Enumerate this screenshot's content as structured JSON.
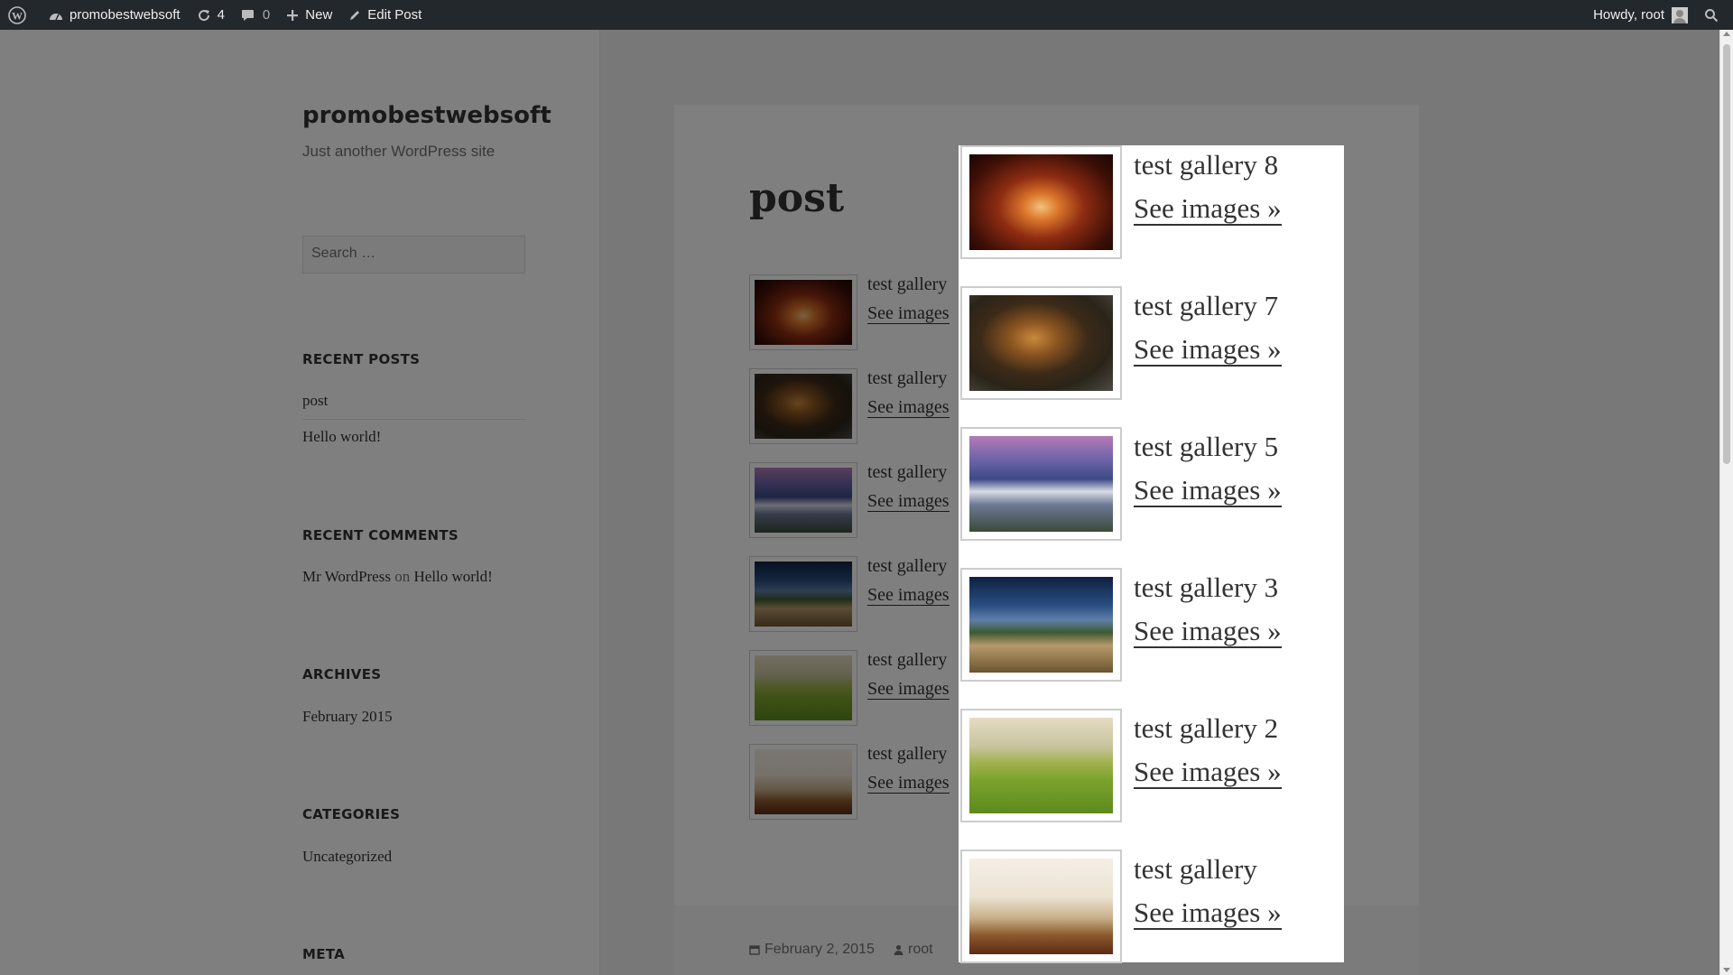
{
  "adminbar": {
    "site_name": "promobestwebsoft",
    "updates_count": "4",
    "comments_count": "0",
    "new_label": "New",
    "edit_label": "Edit Post",
    "howdy": "Howdy, root"
  },
  "sidebar": {
    "site_title": "promobestwebsoft",
    "site_description": "Just another WordPress site",
    "search_placeholder": "Search …",
    "recent_posts": {
      "title": "RECENT POSTS",
      "items": [
        "post",
        "Hello world!"
      ]
    },
    "recent_comments": {
      "title": "RECENT COMMENTS",
      "author": "Mr WordPress",
      "on": "on",
      "post": "Hello world!"
    },
    "archives": {
      "title": "ARCHIVES",
      "items": [
        "February 2015"
      ]
    },
    "categories": {
      "title": "CATEGORIES",
      "items": [
        "Uncategorized"
      ]
    },
    "meta": {
      "title": "META"
    }
  },
  "post": {
    "title": "post",
    "galleries": [
      {
        "title": "test gallery",
        "link": "See images",
        "image": "canyon"
      },
      {
        "title": "test gallery",
        "link": "See images",
        "image": "tiger"
      },
      {
        "title": "test gallery",
        "link": "See images",
        "image": "volcano"
      },
      {
        "title": "test gallery",
        "link": "See images",
        "image": "tuscany"
      },
      {
        "title": "test gallery",
        "link": "See images",
        "image": "hills"
      },
      {
        "title": "test gallery",
        "link": "See images",
        "image": "book"
      }
    ],
    "date": "February 2, 2015",
    "author": "root"
  },
  "popup": {
    "items": [
      {
        "title": "test gallery 8",
        "link": "See images »",
        "image": "canyon"
      },
      {
        "title": "test gallery 7",
        "link": "See images »",
        "image": "tiger"
      },
      {
        "title": "test gallery 5",
        "link": "See images »",
        "image": "volcano"
      },
      {
        "title": "test gallery 3",
        "link": "See images »",
        "image": "tuscany"
      },
      {
        "title": "test gallery 2",
        "link": "See images »",
        "image": "hills"
      },
      {
        "title": "test gallery",
        "link": "See images »",
        "image": "book"
      }
    ]
  }
}
